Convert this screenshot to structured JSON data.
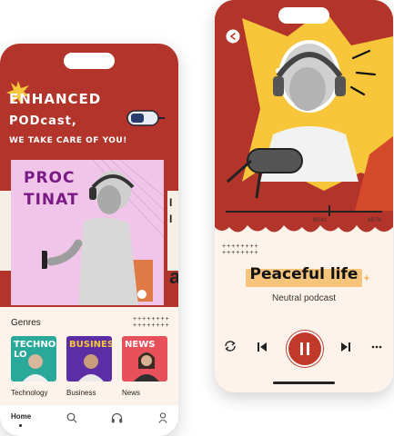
{
  "left_phone": {
    "hero": {
      "line1": "ENHANCED",
      "line2": "PODcast,",
      "line3": "WE TAKE CARE OF YOU!"
    },
    "promo": {
      "line1": "PROC",
      "line2": "TINAT",
      "side1": "I",
      "side2": "I",
      "side3": "a"
    },
    "genres": {
      "label": "Genres",
      "items": [
        {
          "label": "Technology",
          "card_title": "TECHNO LO",
          "color": "#2aa89a"
        },
        {
          "label": "Business",
          "card_title": "BUSINESS",
          "color": "#5b2ea6"
        },
        {
          "label": "News",
          "card_title": "NEWS",
          "color": "#e8505b"
        }
      ]
    },
    "tabbar": {
      "home_label": "Home"
    },
    "icons": [
      "home-icon",
      "search-icon",
      "headphones-icon",
      "profile-icon"
    ]
  },
  "right_phone": {
    "player": {
      "elapsed": "05:41",
      "total": "45:74",
      "title": "Peaceful life",
      "subtitle": "Neutral podcast"
    },
    "icons": [
      "back-icon",
      "repeat-icon",
      "previous-icon",
      "pause-icon",
      "next-icon",
      "more-icon"
    ],
    "colors": {
      "accent": "#c0392b",
      "highlight": "#f5b860",
      "sun": "#f7c63a"
    }
  }
}
